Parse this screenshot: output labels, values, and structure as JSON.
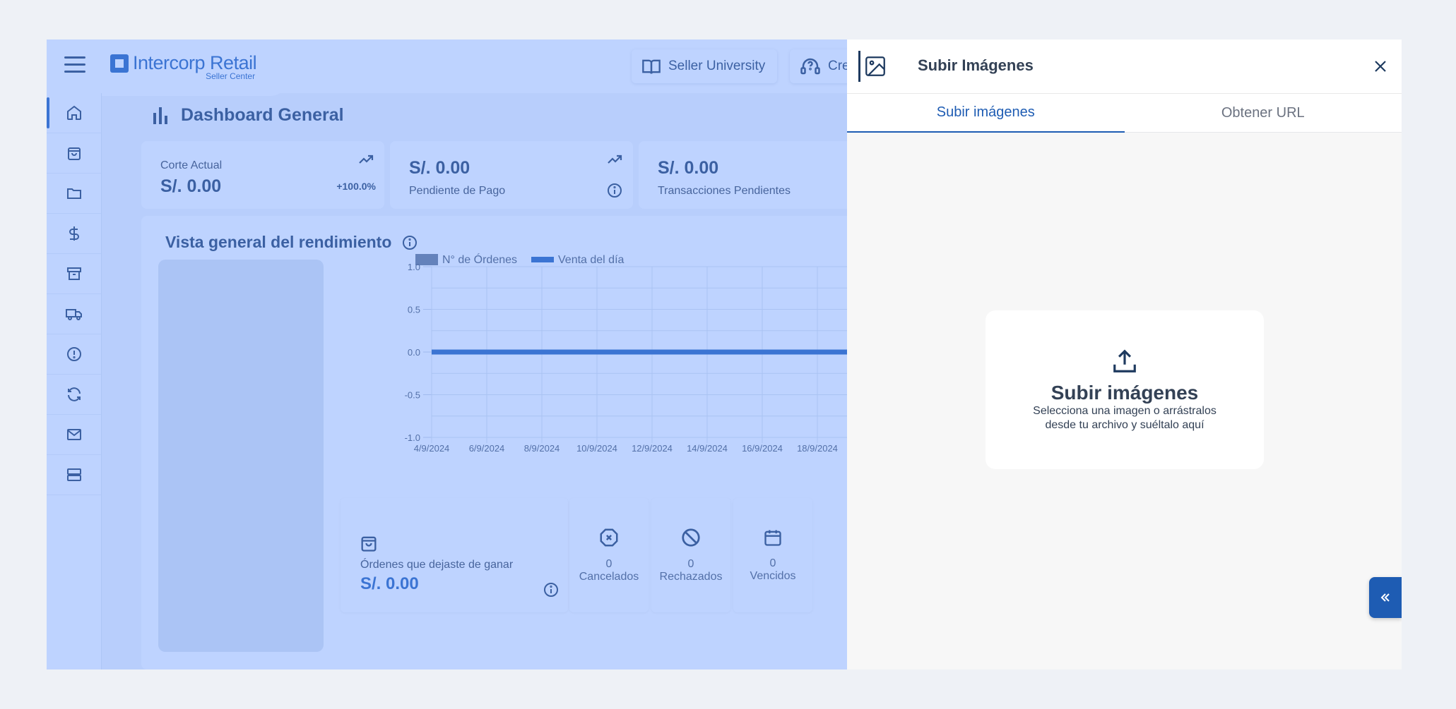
{
  "brand": {
    "name": "Intercorp Retail",
    "sub": "Seller Center"
  },
  "topbar": {
    "seller_university": "Seller University",
    "cre_label": "Cre"
  },
  "sidebar": {
    "items": [
      {
        "icon": "home-icon"
      },
      {
        "icon": "shopping-bag-icon"
      },
      {
        "icon": "folder-icon"
      },
      {
        "icon": "dollar-icon"
      },
      {
        "icon": "archive-icon"
      },
      {
        "icon": "truck-icon"
      },
      {
        "icon": "alert-icon"
      },
      {
        "icon": "refresh-icon"
      },
      {
        "icon": "mail-icon"
      },
      {
        "icon": "server-icon"
      }
    ]
  },
  "dashboard": {
    "title": "Dashboard General",
    "stats": {
      "corte_label": "Corte Actual",
      "corte_value": "S/. 0.00",
      "corte_pct": "+100.0%",
      "pendiente_value": "S/. 0.00",
      "pendiente_label": "Pendiente de Pago",
      "trans_value": "S/. 0.00",
      "trans_label": "Transacciones Pendientes"
    },
    "performance_title": "Vista general del rendimiento",
    "orders": {
      "label": "Órdenes que dejaste de ganar",
      "value": "S/. 0.00",
      "cancelados_count": "0",
      "cancelados_label": "Cancelados",
      "rechazados_count": "0",
      "rechazados_label": "Rechazados",
      "vencidos_count": "0",
      "vencidos_label": "Vencidos"
    }
  },
  "chart_data": {
    "type": "line",
    "legend": [
      "N° de Órdenes",
      "Venta del día"
    ],
    "x": [
      "4/9/2024",
      "6/9/2024",
      "8/9/2024",
      "10/9/2024",
      "12/9/2024",
      "14/9/2024",
      "16/9/2024",
      "18/9/2024"
    ],
    "y_ticks": [
      "1.0",
      "0.5",
      "0.0",
      "-0.5",
      "-1.0"
    ],
    "ylim": [
      -1.0,
      1.0
    ],
    "series": [
      {
        "name": "N° de Órdenes",
        "values": [
          0,
          0,
          0,
          0,
          0,
          0,
          0,
          0
        ]
      },
      {
        "name": "Venta del día",
        "values": [
          0,
          0,
          0,
          0,
          0,
          0,
          0,
          0
        ]
      }
    ],
    "grid": true,
    "legend_position": "top-left",
    "colors": {
      "ordenes": "#64748b",
      "venta": "#1e5cb3"
    }
  },
  "upload_panel": {
    "title": "Subir Imágenes",
    "tabs": [
      "Subir imágenes",
      "Obtener URL"
    ],
    "dropzone_title": "Subir imágenes",
    "dropzone_desc": "Selecciona una imagen o arrástralos desde tu archivo y suéltalo aquí"
  },
  "colors": {
    "brand": "#1e5cb3",
    "overlay": "#6496ff",
    "text_dark": "#1e3a5f"
  }
}
